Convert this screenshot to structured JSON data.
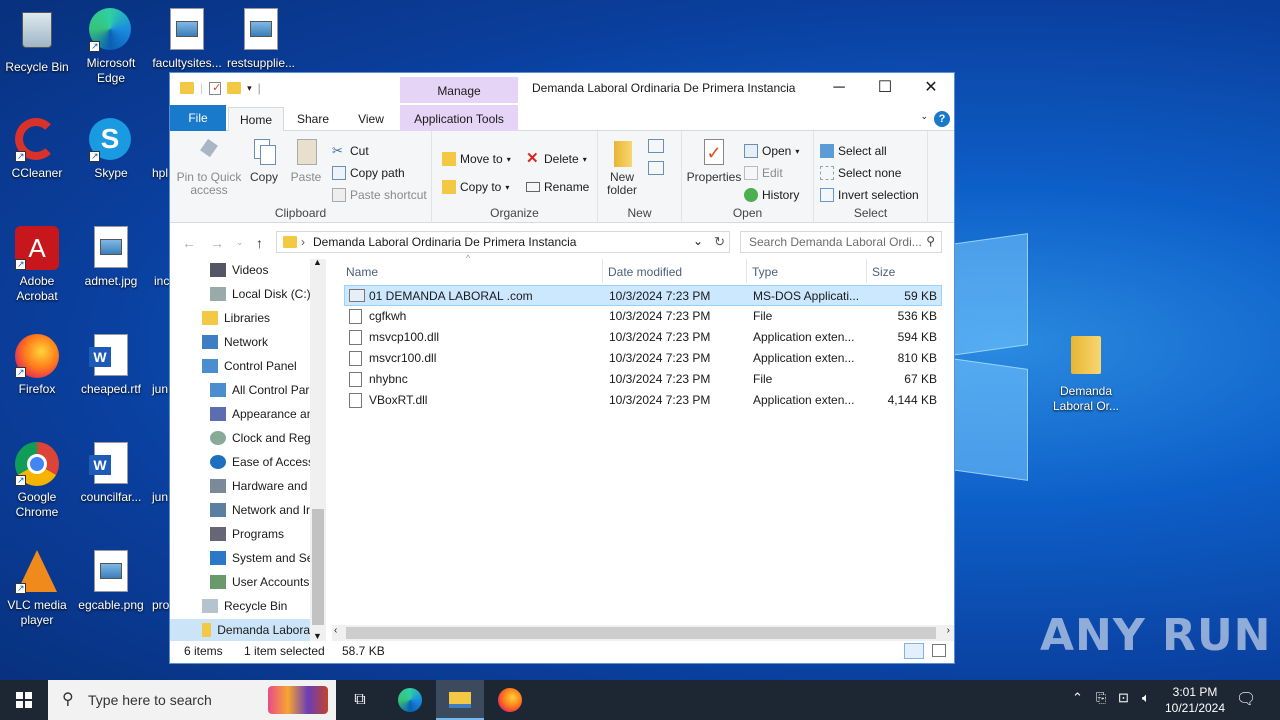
{
  "desktop": {
    "icons": [
      {
        "label": "Recycle Bin"
      },
      {
        "label": "Microsoft Edge"
      },
      {
        "label": "facultysites..."
      },
      {
        "label": "restsupplie..."
      },
      {
        "label": "CCleaner"
      },
      {
        "label": "Skype"
      },
      {
        "label": "hpl"
      },
      {
        "label": "Adobe Acrobat"
      },
      {
        "label": "admet.jpg"
      },
      {
        "label": "inc"
      },
      {
        "label": "Firefox"
      },
      {
        "label": "cheaped.rtf"
      },
      {
        "label": "jun"
      },
      {
        "label": "Google Chrome"
      },
      {
        "label": "councilfar..."
      },
      {
        "label": "jun"
      },
      {
        "label": "VLC media player"
      },
      {
        "label": "egcable.png"
      },
      {
        "label": "pro"
      },
      {
        "label": "Demanda Laboral Or..."
      }
    ]
  },
  "window": {
    "title": "Demanda Laboral Ordinaria De Primera Instancia",
    "manage_tab": "Manage",
    "tabs": {
      "file": "File",
      "home": "Home",
      "share": "Share",
      "view": "View",
      "app_tools": "Application Tools"
    },
    "ribbon": {
      "clipboard": {
        "label": "Clipboard",
        "pin": "Pin to Quick access",
        "copy": "Copy",
        "paste": "Paste",
        "cut": "Cut",
        "copy_path": "Copy path",
        "paste_shortcut": "Paste shortcut"
      },
      "organize": {
        "label": "Organize",
        "move_to": "Move to",
        "copy_to": "Copy to",
        "delete": "Delete",
        "rename": "Rename"
      },
      "new": {
        "label": "New",
        "new_folder": "New folder"
      },
      "open": {
        "label": "Open",
        "properties": "Properties",
        "open": "Open",
        "edit": "Edit",
        "history": "History"
      },
      "select": {
        "label": "Select",
        "select_all": "Select all",
        "select_none": "Select none",
        "invert": "Invert selection"
      }
    },
    "address": "Demanda Laboral Ordinaria De Primera Instancia",
    "search_placeholder": "Search Demanda Laboral Ordi...",
    "nav": [
      "Videos",
      "Local Disk (C:)",
      "Libraries",
      "Network",
      "Control Panel",
      "All Control Par",
      "Appearance an",
      "Clock and Regi",
      "Ease of Access",
      "Hardware and",
      "Network and Ir",
      "Programs",
      "System and Se",
      "User Accounts",
      "Recycle Bin",
      "Demanda Labora"
    ],
    "columns": {
      "name": "Name",
      "date": "Date modified",
      "type": "Type",
      "size": "Size"
    },
    "files": [
      {
        "name": "01 DEMANDA LABORAL .com",
        "date": "10/3/2024 7:23 PM",
        "type": "MS-DOS Applicati...",
        "size": "59 KB"
      },
      {
        "name": "cgfkwh",
        "date": "10/3/2024 7:23 PM",
        "type": "File",
        "size": "536 KB"
      },
      {
        "name": "msvcp100.dll",
        "date": "10/3/2024 7:23 PM",
        "type": "Application exten...",
        "size": "594 KB"
      },
      {
        "name": "msvcr100.dll",
        "date": "10/3/2024 7:23 PM",
        "type": "Application exten...",
        "size": "810 KB"
      },
      {
        "name": "nhybnc",
        "date": "10/3/2024 7:23 PM",
        "type": "File",
        "size": "67 KB"
      },
      {
        "name": "VBoxRT.dll",
        "date": "10/3/2024 7:23 PM",
        "type": "Application exten...",
        "size": "4,144 KB"
      }
    ],
    "status": {
      "items": "6 items",
      "selected": "1 item selected",
      "size": "58.7 KB"
    }
  },
  "taskbar": {
    "search_placeholder": "Type here to search",
    "time": "3:01 PM",
    "date": "10/21/2024"
  },
  "watermark": "ANY RUN"
}
